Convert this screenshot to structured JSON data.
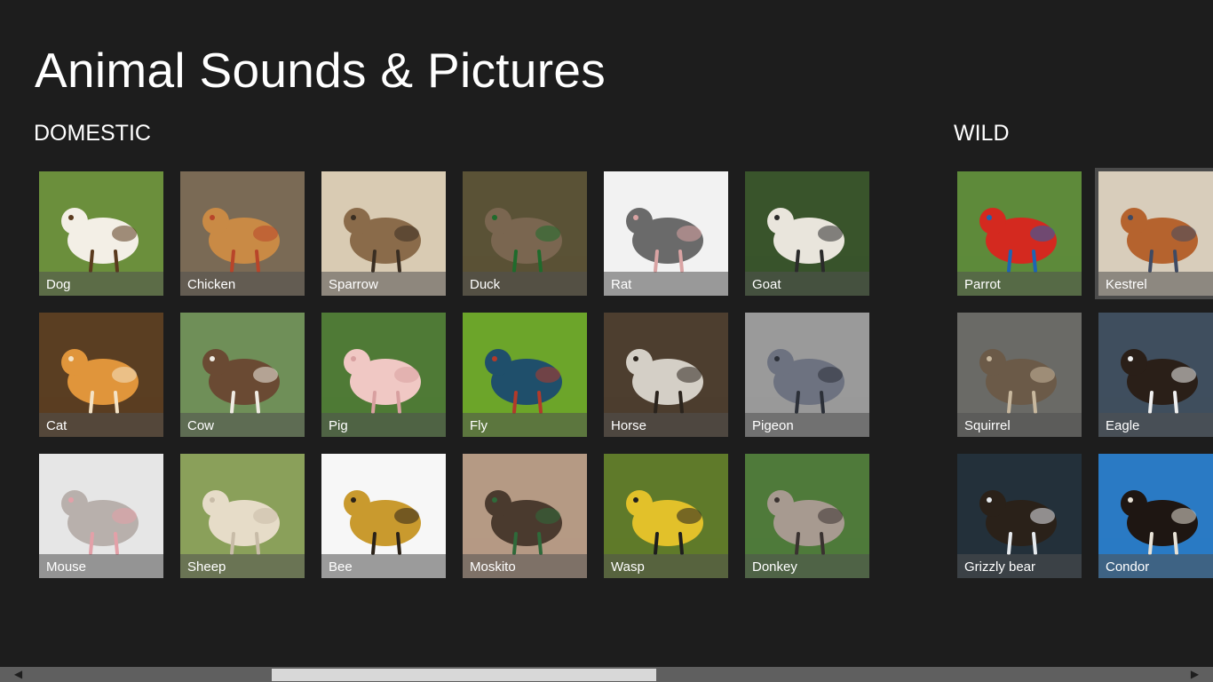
{
  "app": {
    "title": "Animal Sounds & Pictures"
  },
  "sections": {
    "domestic": {
      "title": "DOMESTIC",
      "items": [
        {
          "label": "Dog",
          "bg": "#6b8f3c",
          "fg": "#f3efe6",
          "accent": "#5a3a1e"
        },
        {
          "label": "Chicken",
          "bg": "#7a6a55",
          "fg": "#c98a45",
          "accent": "#b8452a"
        },
        {
          "label": "Sparrow",
          "bg": "#d9cbb3",
          "fg": "#8a6b4a",
          "accent": "#3a2e22"
        },
        {
          "label": "Duck",
          "bg": "#5a5236",
          "fg": "#7a6650",
          "accent": "#1f6b2c"
        },
        {
          "label": "Rat",
          "bg": "#f2f2f2",
          "fg": "#6a6a6a",
          "accent": "#d9a3a3"
        },
        {
          "label": "Goat",
          "bg": "#39542b",
          "fg": "#e9e5dc",
          "accent": "#2b2b2b"
        },
        {
          "label": "Cat",
          "bg": "#5a3e22",
          "fg": "#e0953b",
          "accent": "#f4e3c6"
        },
        {
          "label": "Cow",
          "bg": "#6f8f58",
          "fg": "#6a4a33",
          "accent": "#f0ece4"
        },
        {
          "label": "Pig",
          "bg": "#4f7a36",
          "fg": "#f0c8c4",
          "accent": "#d8a0a0"
        },
        {
          "label": "Fly",
          "bg": "#6ca52a",
          "fg": "#1f4f6b",
          "accent": "#b23a2a"
        },
        {
          "label": "Horse",
          "bg": "#4d3e2f",
          "fg": "#d4cfc6",
          "accent": "#2b241d"
        },
        {
          "label": "Pigeon",
          "bg": "#9a9a9a",
          "fg": "#6d7280",
          "accent": "#2c3038"
        },
        {
          "label": "Mouse",
          "bg": "#e6e6e6",
          "fg": "#b8b0ac",
          "accent": "#e3a0a8"
        },
        {
          "label": "Sheep",
          "bg": "#8aa05a",
          "fg": "#e6dcc8",
          "accent": "#c8bca8"
        },
        {
          "label": "Bee",
          "bg": "#f7f7f7",
          "fg": "#c99a2e",
          "accent": "#2b2218"
        },
        {
          "label": "Moskito",
          "bg": "#b59a84",
          "fg": "#4a3a2e",
          "accent": "#2f6a3a"
        },
        {
          "label": "Wasp",
          "bg": "#5f7a2a",
          "fg": "#e2c12a",
          "accent": "#1e1e1e"
        },
        {
          "label": "Donkey",
          "bg": "#4f7a3a",
          "fg": "#a79a90",
          "accent": "#3a3230"
        }
      ]
    },
    "wild": {
      "title": "WILD",
      "items": [
        {
          "label": "Parrot",
          "bg": "#5e8a3a",
          "fg": "#d4291f",
          "accent": "#1e64b4"
        },
        {
          "label": "Kestrel",
          "bg": "#d8cdbb",
          "fg": "#b5632e",
          "accent": "#3f4a63"
        },
        {
          "label": "Squirrel",
          "bg": "#6a6a66",
          "fg": "#6b5a48",
          "accent": "#c8b89e"
        },
        {
          "label": "Eagle",
          "bg": "#3f4e5e",
          "fg": "#2a1f18",
          "accent": "#f0f0f0"
        },
        {
          "label": "Grizzly bear",
          "bg": "#23303a",
          "fg": "#2a2119",
          "accent": "#e6eaee"
        },
        {
          "label": "Condor",
          "bg": "#2a7ac4",
          "fg": "#1e1612",
          "accent": "#e8e2d6"
        }
      ]
    }
  },
  "selected": "Kestrel",
  "scrollbar": {
    "left_arrow": "left-arrow-icon",
    "right_arrow": "right-arrow-icon"
  }
}
